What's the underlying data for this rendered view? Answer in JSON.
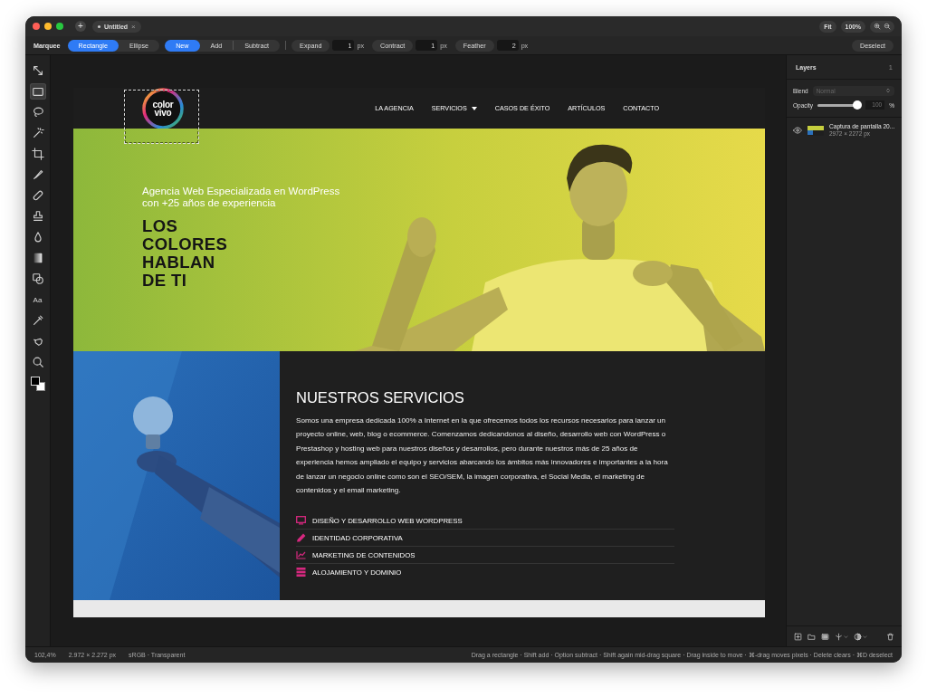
{
  "window": {
    "new_tab": "+",
    "tabs": [
      {
        "label": "Untitled",
        "modified": true,
        "selected": true,
        "close": "×"
      }
    ],
    "view_buttons": [
      "Fit",
      "100%"
    ]
  },
  "toolbar": {
    "tool_name": "Marquee",
    "shape_modes": [
      {
        "label": "Rectangle",
        "selected": true
      },
      {
        "label": "Ellipse",
        "selected": false
      }
    ],
    "combine_modes": [
      {
        "label": "New",
        "selected": true
      },
      {
        "label": "Add",
        "selected": false
      },
      {
        "label": "Subtract",
        "selected": false
      }
    ],
    "adjustments": [
      {
        "label": "Expand",
        "value": "1",
        "unit": "px"
      },
      {
        "label": "Contract",
        "value": "1",
        "unit": "px"
      },
      {
        "label": "Feather",
        "value": "2",
        "unit": "px"
      }
    ],
    "deselect": "Deselect"
  },
  "tools": [
    {
      "kind": "transform",
      "selected": false
    },
    {
      "kind": "rect_marquee",
      "selected": true
    },
    {
      "kind": "lasso",
      "selected": false
    },
    {
      "kind": "wand",
      "selected": false
    },
    {
      "kind": "crop",
      "selected": false
    },
    {
      "kind": "brush",
      "selected": false
    },
    {
      "kind": "bandage",
      "selected": false
    },
    {
      "kind": "stamp",
      "selected": false
    },
    {
      "kind": "drop",
      "selected": false
    },
    {
      "kind": "gradient",
      "selected": false
    },
    {
      "kind": "shapes",
      "selected": false
    },
    {
      "kind": "text",
      "label": "Aa",
      "selected": false
    },
    {
      "kind": "eyedropper",
      "selected": false
    },
    {
      "kind": "smudge",
      "selected": false
    },
    {
      "kind": "zoom",
      "selected": false
    }
  ],
  "canvas": {
    "selection_visible": true,
    "site": {
      "logo": {
        "lines": [
          "color",
          "vivo"
        ]
      },
      "menu": [
        {
          "label": "LA AGENCIA",
          "dropdown": false
        },
        {
          "label": "SERVICIOS",
          "dropdown": true
        },
        {
          "label": "CASOS DE ÉXITO",
          "dropdown": false
        },
        {
          "label": "ARTÍCULOS",
          "dropdown": false
        },
        {
          "label": "CONTACTO",
          "dropdown": false
        }
      ],
      "hero": {
        "subtitle_lines": [
          "Agencia Web Especializada en WordPress",
          "con +25 años de experiencia"
        ],
        "headline_lines": [
          "LOS",
          "COLORES",
          "HABLAN",
          "DE TI"
        ]
      },
      "services": {
        "title": "NUESTROS SERVICIOS",
        "text": "Somos una empresa dedicada 100% a Internet en la que ofrecemos todos los recursos necesarios para lanzar un proyecto online, web, blog o ecommerce. Comenzamos dedicandonos al diseño, desarrollo web con WordPress o Prestashop y hosting web para nuestros diseños y desarrollos, pero durante nuestros más de 25 años de experiencia hemos ampliado el equipo y servicios abarcando los ámbitos más innovadores e importantes a la hora de lanzar un negocio online como son el SEO/SEM, la imagen corporativa, el Social Media, el marketing de contenidos y el email marketing.",
        "items": [
          {
            "kind": "monitor",
            "label": "DISEÑO Y DESARROLLO WEB WORDPRESS"
          },
          {
            "kind": "pencil",
            "label": "IDENTIDAD CORPORATIVA"
          },
          {
            "kind": "chart",
            "label": "MARKETING DE CONTENIDOS"
          },
          {
            "kind": "server",
            "label": "ALOJAMIENTO Y DOMINIO"
          }
        ]
      }
    }
  },
  "layers_panel": {
    "title": "Layers",
    "count": "1",
    "blend": {
      "label": "Blend",
      "placeholder": "Normal",
      "disabled": true
    },
    "opacity": {
      "label": "Opacity",
      "level": 1,
      "reading": "100",
      "unit": "%"
    },
    "layers": [
      {
        "name": "Captura de pantalla 20...",
        "size": "2972 × 2272 px",
        "visible": true
      }
    ]
  },
  "status_bar": {
    "zoom": "102,4%",
    "dimensions": "2.972 × 2.272 px",
    "color_info": "sRGB · Transparent",
    "hint": "Drag a rectangle · Shift add · Option subtract · Shift again mid-drag square · Drag inside to move · ⌘-drag moves pixels · Delete clears · ⌘D deselect"
  }
}
